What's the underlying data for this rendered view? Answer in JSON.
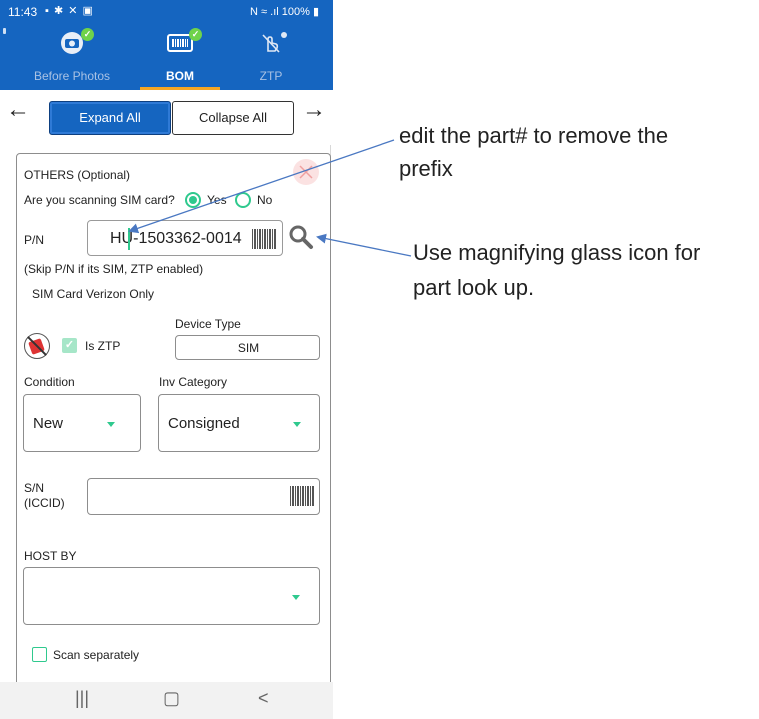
{
  "status_bar": {
    "time": "11:43",
    "left_icons": "▪ ✱ ✕ ▣",
    "right": "N ≈ .ıl 100% ▮"
  },
  "tabs": [
    {
      "label": "Before Photos",
      "icon": "camera-icon",
      "completed": true
    },
    {
      "label": "BOM",
      "icon": "barcode-icon",
      "completed": true
    },
    {
      "label": "ZTP",
      "icon": "ztp-icon",
      "completed": false
    }
  ],
  "nav": {
    "back": "←",
    "forward": "→",
    "expand_label": "Expand All",
    "collapse_label": "Collapse All"
  },
  "form": {
    "section_title": "OTHERS (Optional)",
    "sim_question": "Are you scanning SIM card?",
    "yes_label": "Yes",
    "no_label": "No",
    "pn_label": "P/N",
    "pn_value": "HU-1503362-0014",
    "skip_note": "(Skip P/N if its SIM, ZTP enabled)",
    "sim_note": "SIM Card Verizon Only",
    "device_type_label": "Device Type",
    "device_type_value": "SIM",
    "is_ztp_label": "Is ZTP",
    "condition_label": "Condition",
    "condition_value": "New",
    "inv_category_label": "Inv Category",
    "inv_category_value": "Consigned",
    "sn_label_line1": "S/N",
    "sn_label_line2": "(ICCID)",
    "sn_value": "",
    "host_by_label": "HOST BY",
    "host_by_value": "",
    "scan_separately_label": "Scan separately"
  },
  "bottom_nav": {
    "recent": "|||",
    "home": "▢",
    "back": "<"
  },
  "annotations": {
    "edit_line1": "edit the part# to remove the",
    "edit_line2": "prefix",
    "mag_line1": "Use magnifying glass icon for",
    "mag_line2": "part look up."
  },
  "colors": {
    "primary": "#1565c0",
    "accent": "#2fc98e",
    "tab_indicator": "#f5a623",
    "check": "#6fd34a",
    "arrow": "#4a78c2"
  }
}
